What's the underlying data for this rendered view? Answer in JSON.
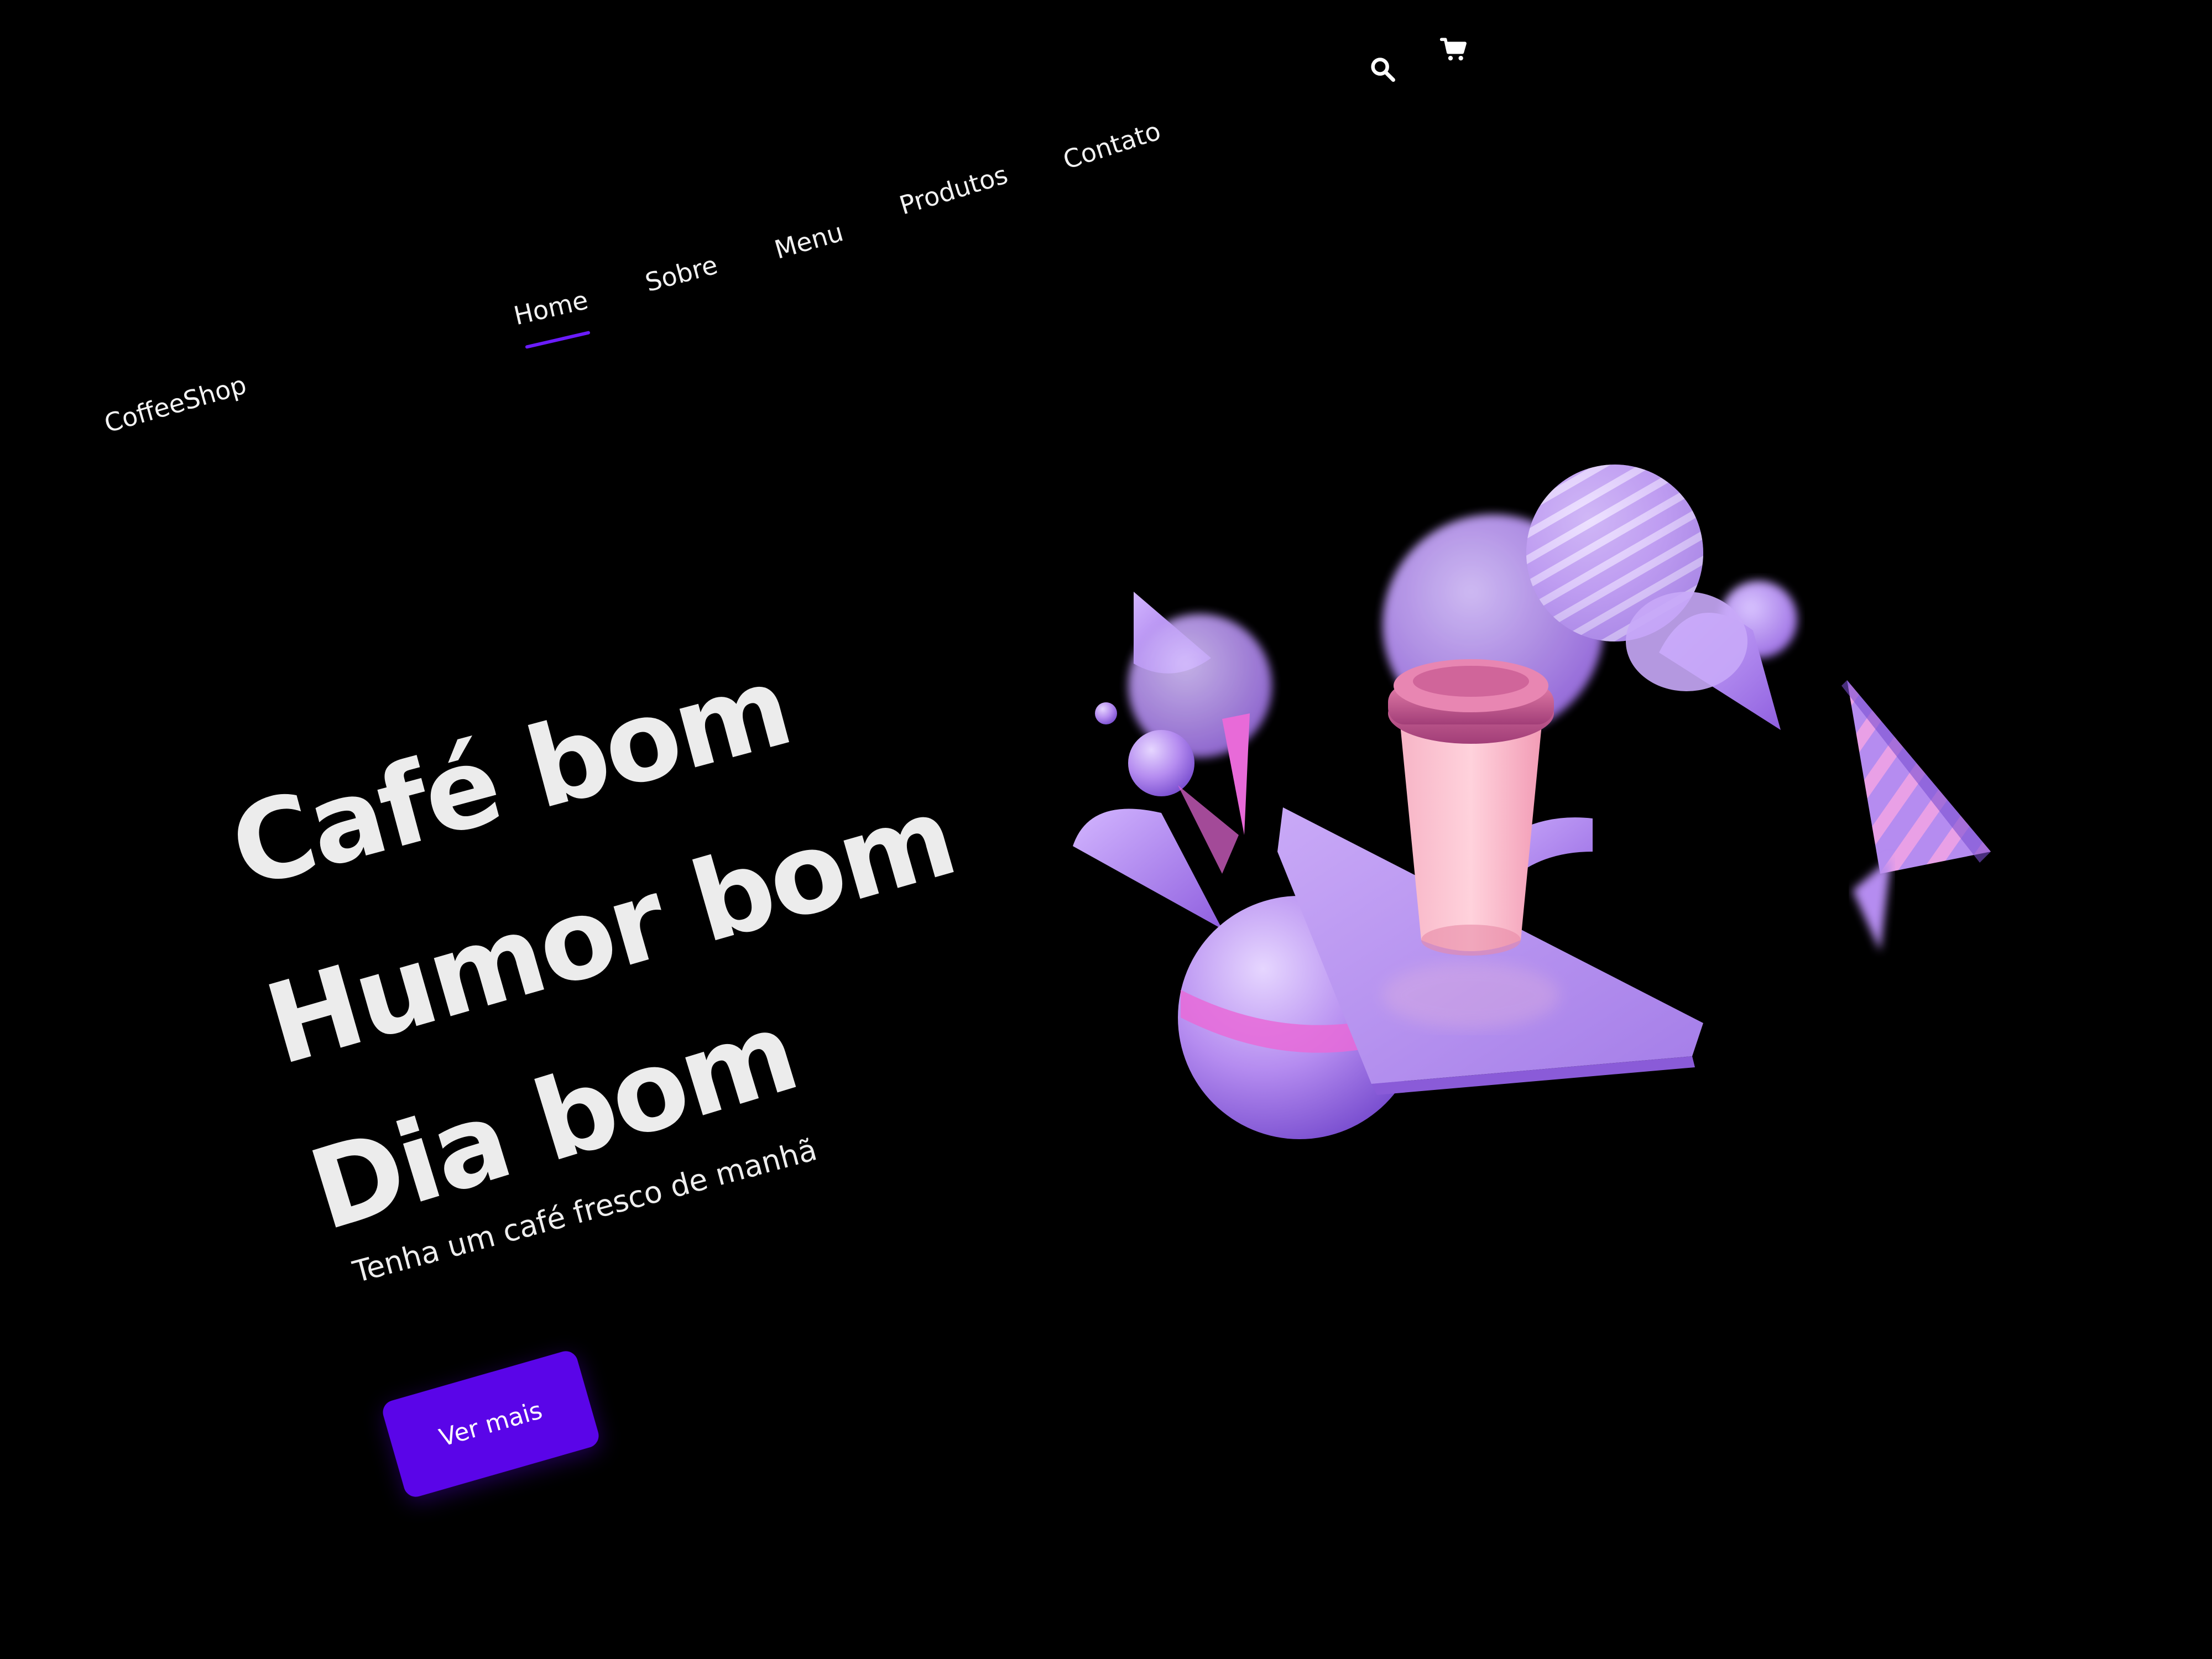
{
  "brand": {
    "logo_text": "CoffeeShop"
  },
  "nav": {
    "items": [
      {
        "label": "Home",
        "active": true
      },
      {
        "label": "Sobre",
        "active": false
      },
      {
        "label": "Menu",
        "active": false
      },
      {
        "label": "Produtos",
        "active": false
      },
      {
        "label": "Contato",
        "active": false
      }
    ],
    "active_color": "#6b1cff"
  },
  "header_icons": {
    "search": "search-icon",
    "cart": "cart-icon"
  },
  "hero": {
    "headline_lines": [
      "Café bom",
      "Humor bom",
      "Dia bom"
    ],
    "subtitle": "Tenha um café fresco de manhã",
    "cta_label": "Ver mais",
    "cta_color": "#5a05e8",
    "illustration": "coffee-cup-with-3d-shapes"
  },
  "colors": {
    "background": "#000000",
    "text": "#ececec",
    "accent_purple": "#b58cf0",
    "accent_pink": "#e86ad8"
  }
}
